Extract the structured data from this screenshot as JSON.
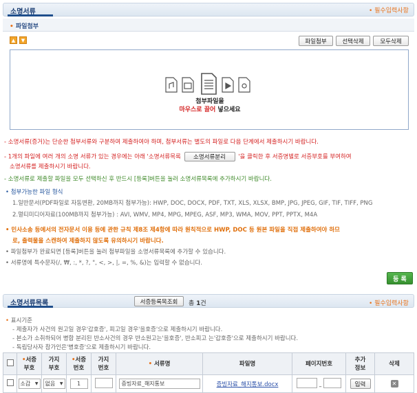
{
  "section1": {
    "title": "소명서류",
    "required_note": "필수입력사항"
  },
  "attach": {
    "title": "파일첨부",
    "buttons": {
      "attach": "파일첨부",
      "delete_selected": "선택삭제",
      "delete_all": "모두삭제"
    },
    "drop_text1": "첨부파일을",
    "drop_red": "마우스로 끌어",
    "drop_text2": " 넣으세요"
  },
  "notes": {
    "n1": "- 소명서류(증거)는 단순한 첨부서류와 구분하여 제출하여야 하며, 첨부서류는 별도의 파일로 다음 단계에서 제출하시기 바랍니다.",
    "n2a": "- 1개의 파일에 여러 개의 소명 서류가 있는 경우에는 아래 '소명서류목록",
    "n2_button": "소명서류분리",
    "n2b": "'을 클릭한 후 서증명별로 서증부호를 부여하여",
    "n2c": "소명서류를 제출하시기 바랍니다.",
    "n3": "- 소명서류로 제출할 파일을 모두 선택하신 후 반드시 [등록]버튼을 눌러 소명서류목록에 추가하시기 바랍니다.",
    "formats_title": "첨부가능한 파일 형식",
    "formats1": "1.일반문서(PDF파일로 자동변환, 20MB까지 첨부가능): HWP, DOC, DOCX, PDF, TXT, XLS, XLSX, BMP, JPG, JPEG, GIF, TIF, TIFF, PNG",
    "formats2": "2.멀티미디어자료(100MB까지 첨부가능) : AVI, WMV, MP4, MPG, MPEG, ASF, MP3, WMA, MOV, PPT, PPTX, M4A",
    "warn1": "민사소송 등에서의 전자문서 이용 등에 관한 규칙 제8조 제4항에 따라 원칙적으로 HWP, DOC 등 원본 파일을 직접 제출하여야 하므",
    "warn2": "로, 출력물을 스캔하여 제출하지 않도록 유의하시기 바랍니다.",
    "bullet2": "파일첨부가 완료되면 [등록]버튼을 눌러 첨부파일을 소명서류목록에 추가할 수 있습니다.",
    "bullet3": "서류명에 특수문자(/, ₩, :, *, ?, \", <, >, |, =, %, &)는 입력할 수 없습니다."
  },
  "register_button": "등 록",
  "section2": {
    "title": "소명서류목록",
    "search_button": "서증등록목조회",
    "count_prefix": "총 ",
    "count": "1",
    "count_suffix": "건",
    "required_note": "필수입력사항"
  },
  "guide": {
    "title": "표시기준",
    "l1": "- 제출자가 사건의 원고일 경우'갑호증', 피고일 경우'을호증'으로 제출하시기 바랍니다.",
    "l2": "- 본소가 소취하되어 병합 분리된 반소사건의 경우 반소원고는'을호증', 반소피고 는'갑호증'으로 제출하시기 바랍니다.",
    "l3": "- 독립당사자 참가인은'병호증'으로 제출하시기 바랍니다."
  },
  "table": {
    "headers": {
      "c2a": "서증",
      "c2b": "부호",
      "c3a": "가지",
      "c3b": "부호",
      "c4a": "서증",
      "c4b": "번호",
      "c5a": "가지",
      "c5b": "번호",
      "c6": "서류명",
      "c7": "파일명",
      "c8": "페이지번호",
      "c9a": "추가",
      "c9b": "정보",
      "c10": "삭제"
    },
    "rows": [
      {
        "code": "소갑",
        "branch_code": "없음",
        "number": "1",
        "branch_number": "",
        "doc_name": "증빙자료_해지통보",
        "file_name": "증빙자료_해지통보.docx",
        "page_from": "",
        "page_to": "",
        "extra_button": "입력"
      }
    ]
  },
  "colors": {
    "accent": "#1f4e8c",
    "required": "#e8731c",
    "register": "#3e9d3a"
  }
}
